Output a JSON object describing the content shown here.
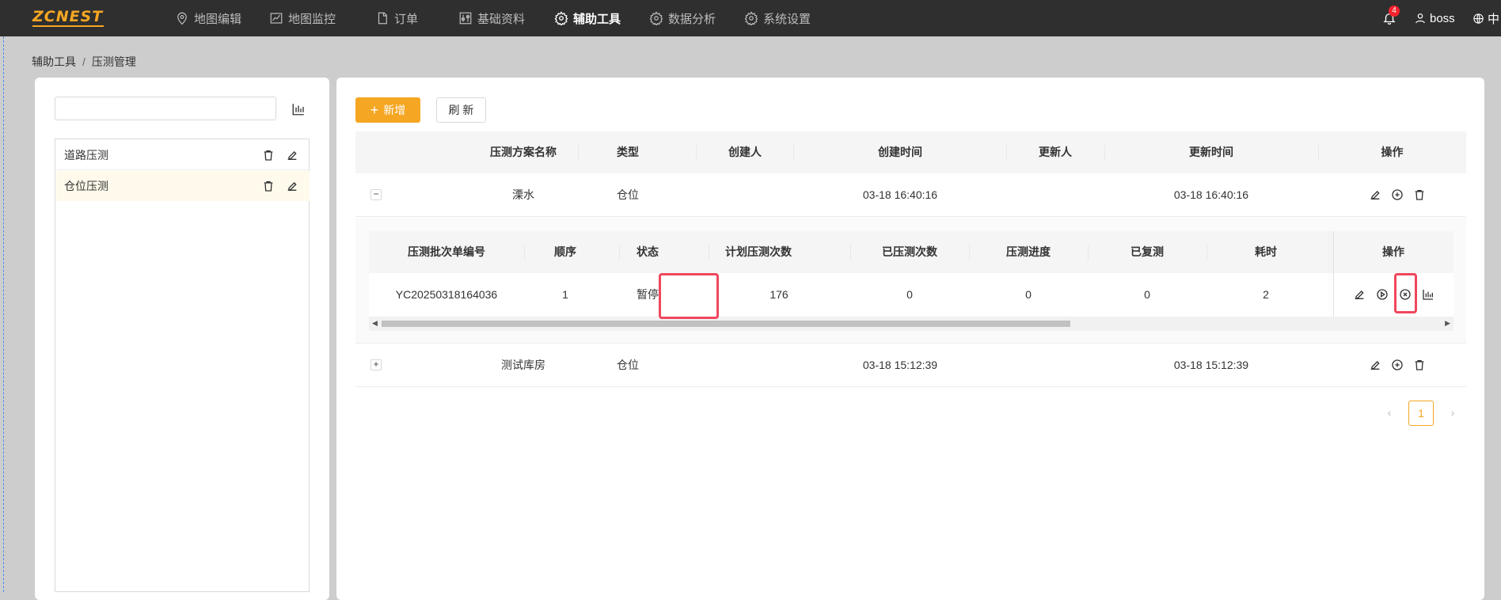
{
  "app": {
    "logo_text": "ZCNEST"
  },
  "nav": {
    "items": [
      {
        "label": "地图编辑",
        "icon": "location-pin-icon"
      },
      {
        "label": "地图监控",
        "icon": "line-chart-icon"
      },
      {
        "label": "订单",
        "icon": "document-icon"
      },
      {
        "label": "基础资料",
        "icon": "sliders-icon"
      },
      {
        "label": "辅助工具",
        "icon": "gear-icon",
        "active": true
      },
      {
        "label": "数据分析",
        "icon": "gear-icon"
      },
      {
        "label": "系统设置",
        "icon": "gear-icon"
      }
    ],
    "notification_count": "4",
    "user": "boss",
    "language": "中"
  },
  "breadcrumb": {
    "parent": "辅助工具",
    "separator": "/",
    "current": "压测管理"
  },
  "left": {
    "search": {
      "value": "",
      "placeholder": ""
    },
    "items": [
      {
        "label": "道路压测"
      },
      {
        "label": "仓位压测",
        "selected": true
      }
    ]
  },
  "toolbar": {
    "add_label": "新增",
    "refresh_label": "刷 新"
  },
  "table": {
    "columns": [
      "压测方案名称",
      "类型",
      "创建人",
      "创建时间",
      "更新人",
      "更新时间",
      "操作"
    ],
    "rows": [
      {
        "expand": "−",
        "name": "溧水",
        "type": "仓位",
        "creator": "",
        "created": "03-18 16:40:16",
        "updater": "",
        "updated": "03-18 16:40:16"
      },
      {
        "expand": "+",
        "name": "测试库房",
        "type": "仓位",
        "creator": "",
        "created": "03-18 15:12:39",
        "updater": "",
        "updated": "03-18 15:12:39"
      }
    ]
  },
  "subtable": {
    "columns": [
      "压测批次单编号",
      "顺序",
      "状态",
      "计划压测次数",
      "已压测次数",
      "压测进度",
      "已复测",
      "耗时",
      "操作"
    ],
    "row": {
      "batch_no": "YC20250318164036",
      "order": "1",
      "status": "暂停",
      "planned": "176",
      "done": "0",
      "progress": "0",
      "retested": "0",
      "duration": "2"
    }
  },
  "pagination": {
    "current": "1",
    "prev": "‹",
    "next": "›"
  },
  "colors": {
    "accent": "#f5a623",
    "topbar": "#2f2f2f",
    "highlight": "#f0475c",
    "badge": "#f5222d"
  }
}
